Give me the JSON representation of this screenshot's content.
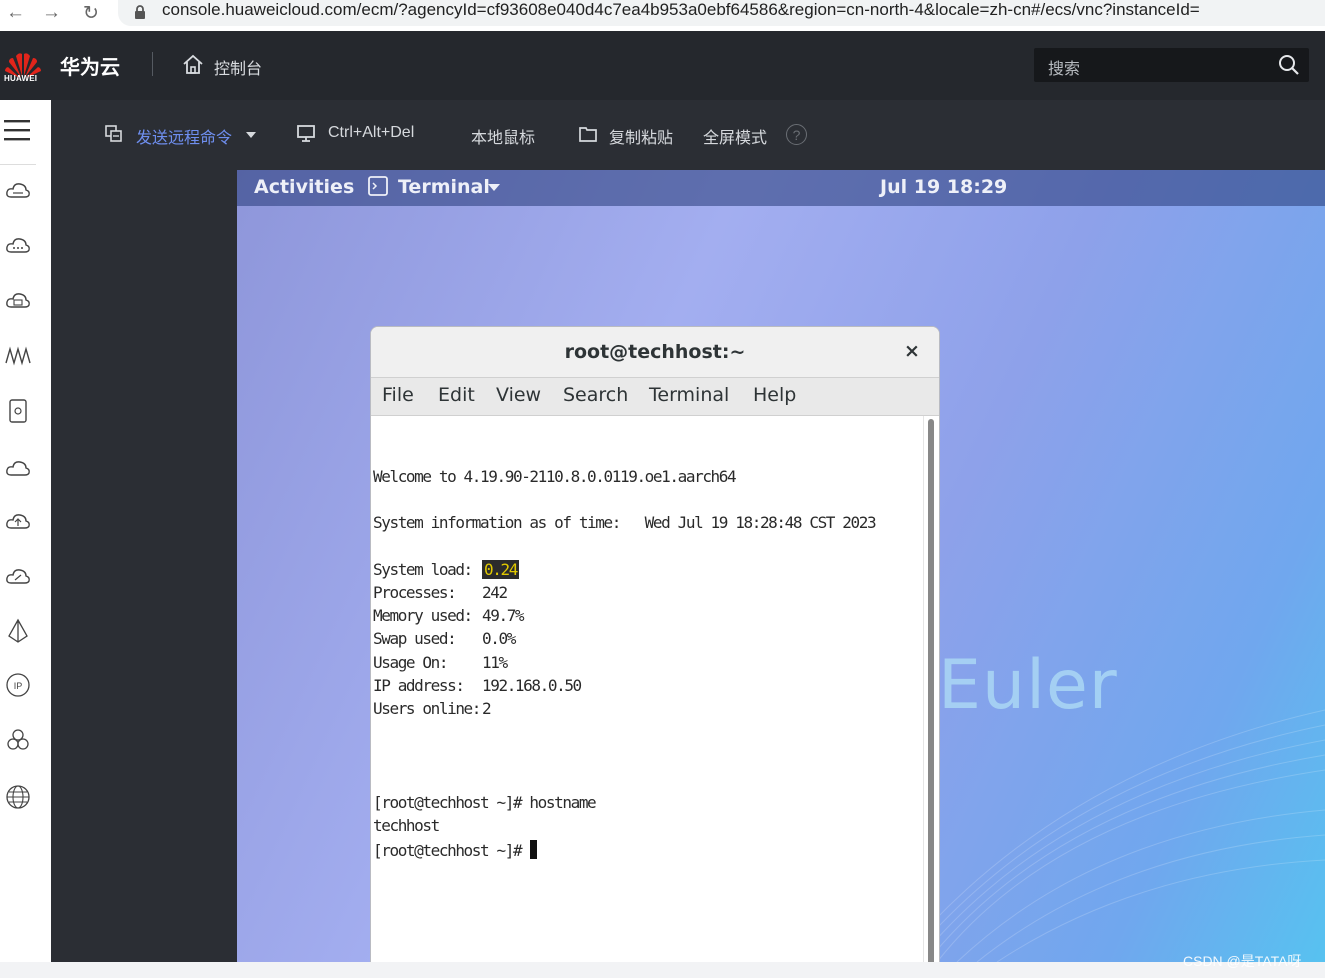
{
  "browser": {
    "url": "console.huaweicloud.com/ecm/?agencyId=cf93608e040d4c7ea4b953a0ebf64586&region=cn-north-4&locale=zh-cn#/ecs/vnc?instanceId="
  },
  "header": {
    "logo_text": "HUAWEI",
    "brand": "华为云",
    "console_label": "控制台",
    "search_placeholder": "搜索"
  },
  "toolbar": {
    "remote_cmd": "发送远程命令",
    "ctrl_alt_del": "Ctrl+Alt+Del",
    "local_mouse": "本地鼠标",
    "copy_paste": "复制粘贴",
    "fullscreen": "全屏模式",
    "help": "?"
  },
  "gnome": {
    "activities": "Activities",
    "app_name": "Terminal",
    "clock": "Jul 19  18:29",
    "wallpaper_text": "Euler"
  },
  "terminal": {
    "title": "root@techhost:~",
    "close": "×",
    "menu": [
      "File",
      "Edit",
      "View",
      "Search",
      "Terminal",
      "Help"
    ],
    "welcome": "Welcome to 4.19.90-2110.8.0.0119.oe1.aarch64",
    "sysinfo": "System information as of time:   Wed Jul 19 18:28:48 CST 2023",
    "stats": [
      {
        "label": "System load:",
        "value": "0.24"
      },
      {
        "label": "Processes:",
        "value": "242"
      },
      {
        "label": "Memory used:",
        "value": "49.7%"
      },
      {
        "label": "Swap used:",
        "value": "0.0%"
      },
      {
        "label": "Usage On:",
        "value": "11%"
      },
      {
        "label": "IP address:",
        "value": "192.168.0.50"
      },
      {
        "label": "Users online:",
        "value": "2"
      }
    ],
    "cmd1": "[root@techhost ~]# hostname",
    "out1": "techhost",
    "prompt": "[root@techhost ~]# "
  },
  "watermark": "CSDN @是TATA呀"
}
